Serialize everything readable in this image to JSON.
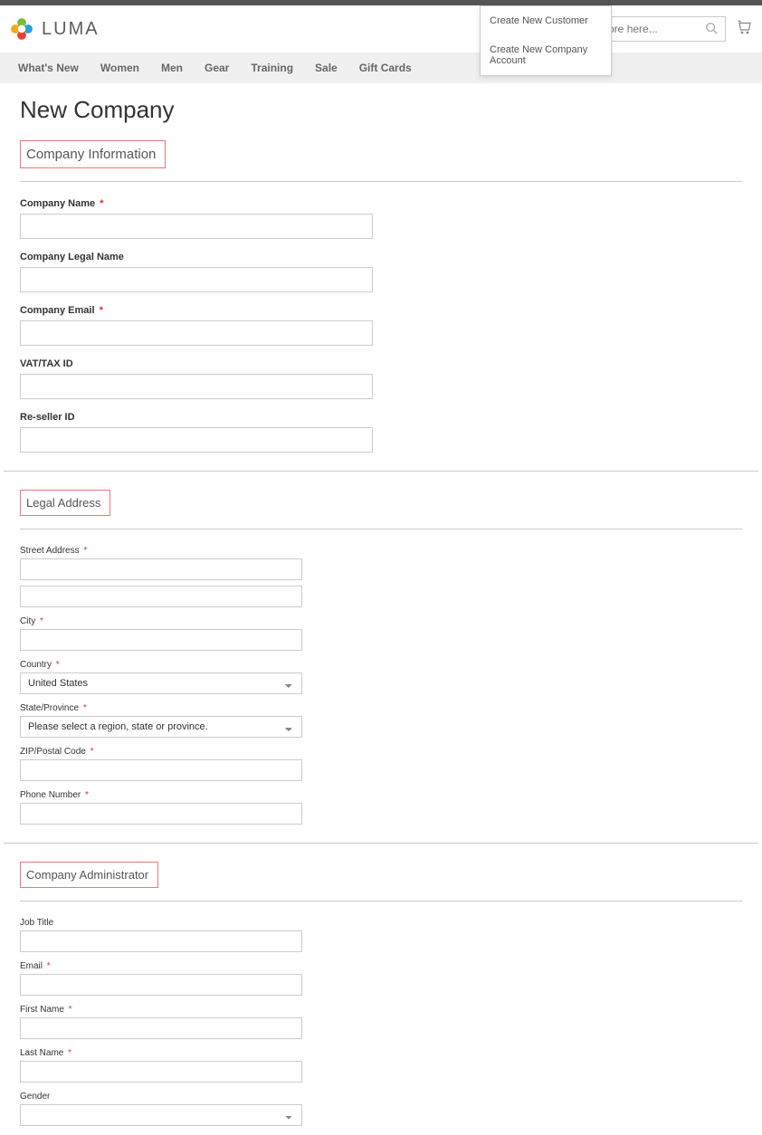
{
  "brand": "LUMA",
  "search": {
    "placeholder": "ntire store here..."
  },
  "dropdown": {
    "item1": "Create New Customer",
    "item2": "Create New Company Account"
  },
  "nav": {
    "whatsnew": "What's New",
    "women": "Women",
    "men": "Men",
    "gear": "Gear",
    "training": "Training",
    "sale": "Sale",
    "giftcards": "Gift Cards"
  },
  "page_title": "New Company",
  "sections": {
    "company_info": {
      "title": "Company Information",
      "company_name": "Company Name",
      "company_legal_name": "Company Legal Name",
      "company_email": "Company Email",
      "vat": "VAT/TAX ID",
      "reseller": "Re-seller ID"
    },
    "legal_address": {
      "title": "Legal Address",
      "street": "Street Address",
      "city": "City",
      "country_label": "Country",
      "country_value": "United States",
      "state_label": "State/Province",
      "state_value": "Please select a region, state or province.",
      "zip": "ZIP/Postal Code",
      "phone": "Phone Number"
    },
    "admin": {
      "title": "Company Administrator",
      "job_title": "Job Title",
      "email": "Email",
      "first_name": "First Name",
      "last_name": "Last Name",
      "gender": "Gender"
    }
  }
}
